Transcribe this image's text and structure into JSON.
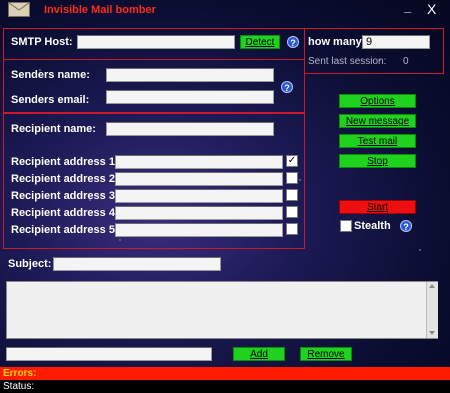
{
  "title": "Invisible Mail bomber",
  "window": {
    "minimize": "_",
    "close": "X"
  },
  "smtp": {
    "label": "SMTP Host:",
    "value": "",
    "detect": "Detect"
  },
  "howmany": {
    "label": "how many:",
    "value": "9",
    "sent_label": "Sent last session:",
    "sent_value": "0"
  },
  "sender": {
    "name_label": "Senders name:",
    "name_value": "",
    "email_label": "Senders email:",
    "email_value": ""
  },
  "recipient": {
    "name_label": "Recipient name:",
    "name_value": "",
    "addresses": [
      {
        "label": "Recipient address 1:",
        "value": "",
        "checked": true
      },
      {
        "label": "Recipient address 2:",
        "value": "",
        "checked": false
      },
      {
        "label": "Recipient address 3:",
        "value": "",
        "checked": false
      },
      {
        "label": "Recipient address 4:",
        "value": "",
        "checked": false
      },
      {
        "label": "Recipient address 5:",
        "value": "",
        "checked": false
      }
    ]
  },
  "buttons": {
    "options": "Options",
    "new_message": "New message",
    "test_mail": "Test mail",
    "stop": "Stop",
    "start": "Start",
    "add": "Add",
    "remove": "Remove"
  },
  "stealth": {
    "label": "Stealth",
    "checked": false
  },
  "subject": {
    "label": "Subject:",
    "value": ""
  },
  "message": {
    "value": ""
  },
  "attachment": {
    "value": ""
  },
  "status": {
    "errors_label": "Errors:",
    "status_label": "Status:"
  },
  "help_glyph": "?",
  "check_glyph": "✓",
  "colors": {
    "accent_red": "#d0162a",
    "button_green": "#1ed21e",
    "button_red": "#ee1010",
    "errors_bar": "#ff1a00"
  }
}
